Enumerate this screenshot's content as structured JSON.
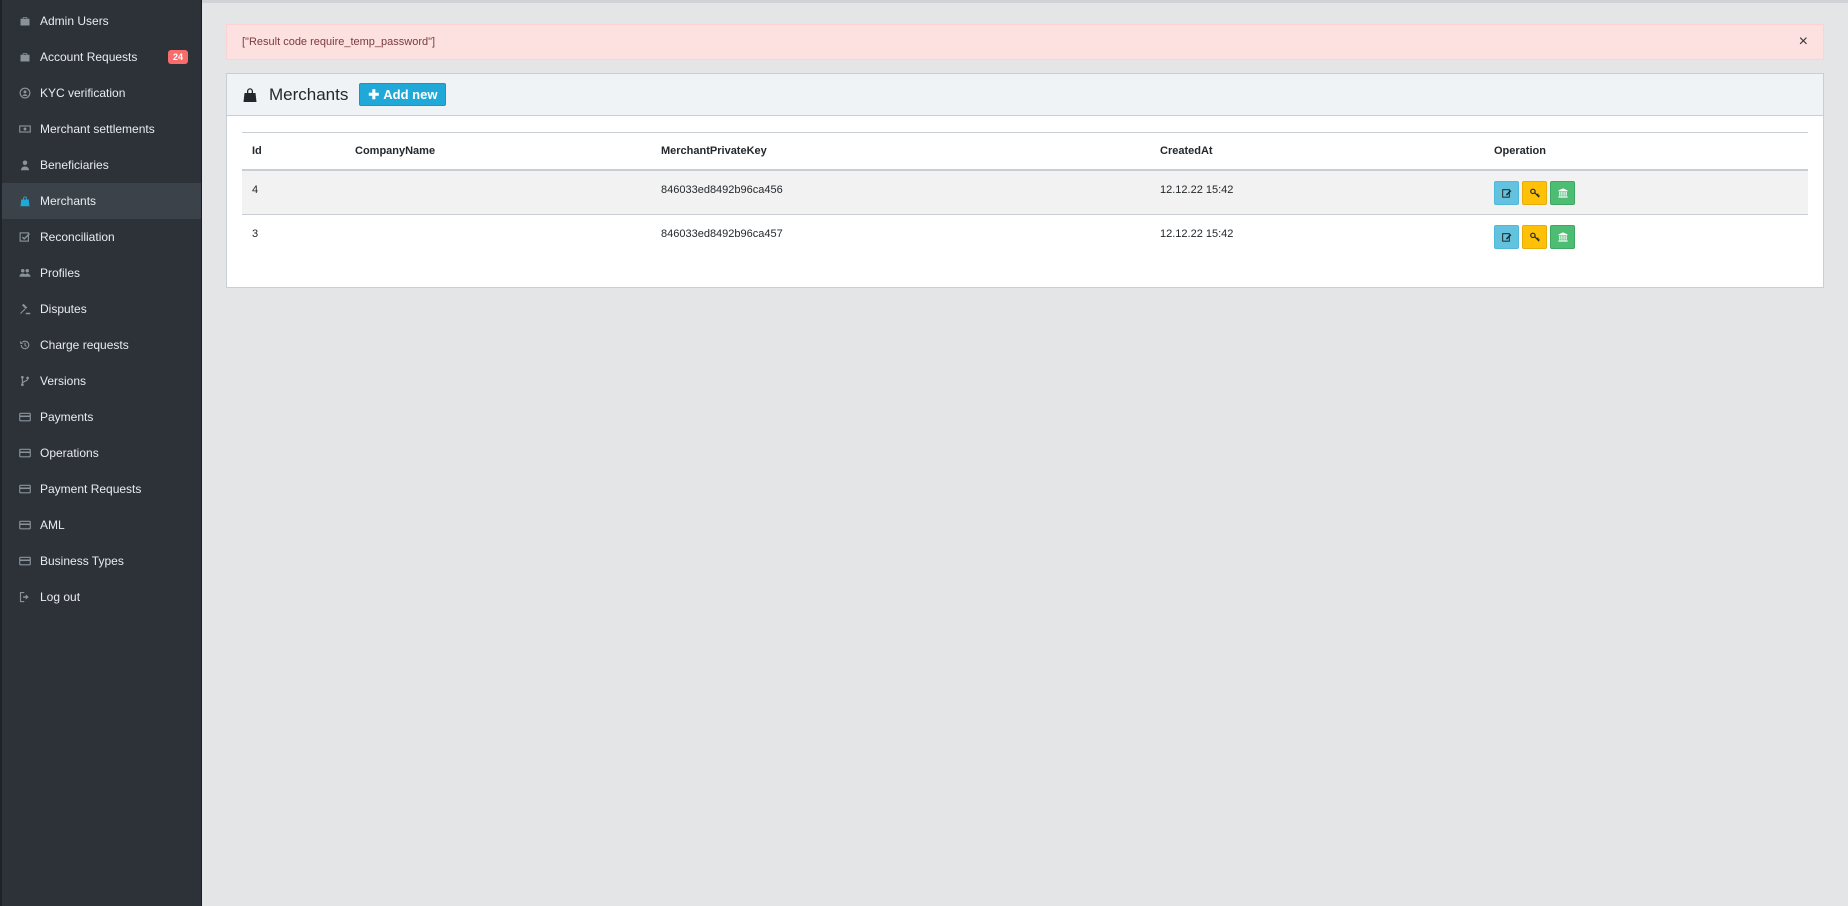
{
  "sidebar": {
    "items": [
      {
        "label": "Admin Users",
        "icon": "briefcase-icon"
      },
      {
        "label": "Account Requests",
        "icon": "briefcase-icon",
        "badge": "24"
      },
      {
        "label": "KYC verification",
        "icon": "user-circle-icon"
      },
      {
        "label": "Merchant settlements",
        "icon": "money-icon"
      },
      {
        "label": "Beneficiaries",
        "icon": "user-icon"
      },
      {
        "label": "Merchants",
        "icon": "shopping-bag-icon",
        "active": true
      },
      {
        "label": "Reconciliation",
        "icon": "check-square-icon"
      },
      {
        "label": "Profiles",
        "icon": "users-icon"
      },
      {
        "label": "Disputes",
        "icon": "gavel-icon"
      },
      {
        "label": "Charge requests",
        "icon": "history-icon"
      },
      {
        "label": "Versions",
        "icon": "code-branch-icon"
      },
      {
        "label": "Payments",
        "icon": "credit-card-icon"
      },
      {
        "label": "Operations",
        "icon": "credit-card-icon"
      },
      {
        "label": "Payment Requests",
        "icon": "credit-card-icon"
      },
      {
        "label": "AML",
        "icon": "credit-card-icon"
      },
      {
        "label": "Business Types",
        "icon": "credit-card-icon"
      },
      {
        "label": "Log out",
        "icon": "sign-out-icon"
      }
    ]
  },
  "alert": {
    "message": "[\"Result code require_temp_password\"]",
    "close": "×"
  },
  "card": {
    "title": "Merchants",
    "add_label": "Add new",
    "add_icon": "plus-icon"
  },
  "table": {
    "headers": [
      "Id",
      "CompanyName",
      "MerchantPrivateKey",
      "CreatedAt",
      "Operation"
    ],
    "rows": [
      {
        "id": "4",
        "company": "",
        "key": "846033ed8492b96ca456",
        "created": "12.12.22 15:42"
      },
      {
        "id": "3",
        "company": "",
        "key": "846033ed8492b96ca457",
        "created": "12.12.22 15:42"
      }
    ],
    "operations": [
      {
        "icon": "edit-icon",
        "color": "#63c2de"
      },
      {
        "icon": "key-icon",
        "color": "#ffc107"
      },
      {
        "icon": "bank-icon",
        "color": "#4dbd74"
      }
    ]
  },
  "colors": {
    "sidebar_bg": "#2c3238",
    "active_item": "#3b4249",
    "accent": "#20a8d8",
    "badge": "#f86c6b",
    "alert_bg": "#fde1e1"
  }
}
